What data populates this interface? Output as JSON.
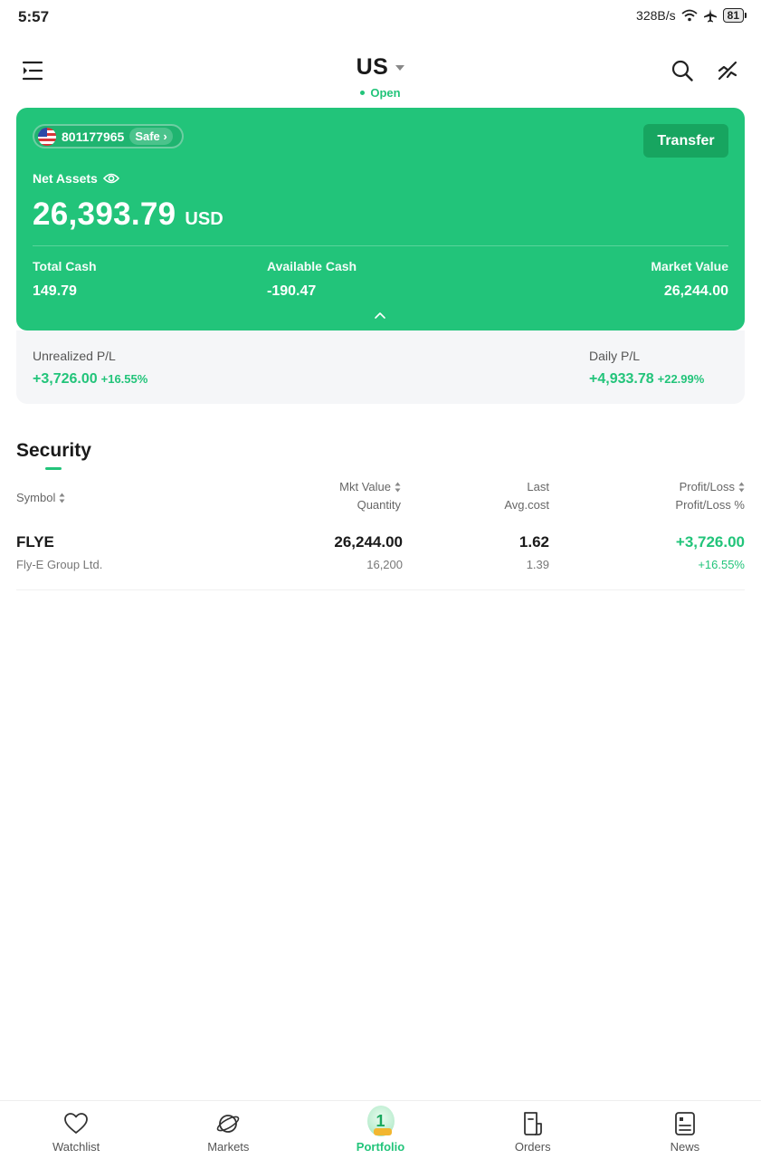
{
  "status_bar": {
    "time": "5:57",
    "net_speed": "328B/s",
    "battery": "81"
  },
  "header": {
    "market": "US",
    "market_status": "Open",
    "icons": [
      "menu-icon",
      "search-icon",
      "edit-icon"
    ]
  },
  "account": {
    "number": "801177965",
    "safe_label": "Safe",
    "transfer_label": "Transfer",
    "net_assets_label": "Net Assets",
    "net_assets_value": "26,393.79",
    "currency": "USD",
    "total_cash_label": "Total Cash",
    "total_cash_value": "149.79",
    "available_cash_label": "Available Cash",
    "available_cash_value": "-190.47",
    "market_value_label": "Market Value",
    "market_value_value": "26,244.00"
  },
  "pl": {
    "unrealized_label": "Unrealized P/L",
    "unrealized_value": "+3,726.00",
    "unrealized_pct": "+16.55%",
    "daily_label": "Daily P/L",
    "daily_value": "+4,933.78",
    "daily_pct": "+22.99%"
  },
  "security": {
    "title": "Security",
    "columns": {
      "symbol": "Symbol",
      "mkt_value": "Mkt Value",
      "quantity": "Quantity",
      "last": "Last",
      "avg_cost": "Avg.cost",
      "profit_loss": "Profit/Loss",
      "profit_loss_pct": "Profit/Loss %"
    },
    "rows": [
      {
        "symbol": "FLYE",
        "name": "Fly-E Group Ltd.",
        "mkt_value": "26,244.00",
        "quantity": "16,200",
        "last": "1.62",
        "avg_cost": "1.39",
        "profit_loss": "+3,726.00",
        "profit_loss_pct": "+16.55%"
      }
    ]
  },
  "bottom_nav": {
    "items": [
      {
        "label": "Watchlist",
        "icon": "heart-icon"
      },
      {
        "label": "Markets",
        "icon": "planet-icon"
      },
      {
        "label": "Portfolio",
        "icon": "portfolio-badge-icon",
        "badge": "1",
        "active": true
      },
      {
        "label": "Orders",
        "icon": "orders-icon"
      },
      {
        "label": "News",
        "icon": "news-icon"
      }
    ]
  },
  "colors": {
    "accent": "#22c47a",
    "accent_dark": "#17a560",
    "panel": "#f5f6f8"
  }
}
